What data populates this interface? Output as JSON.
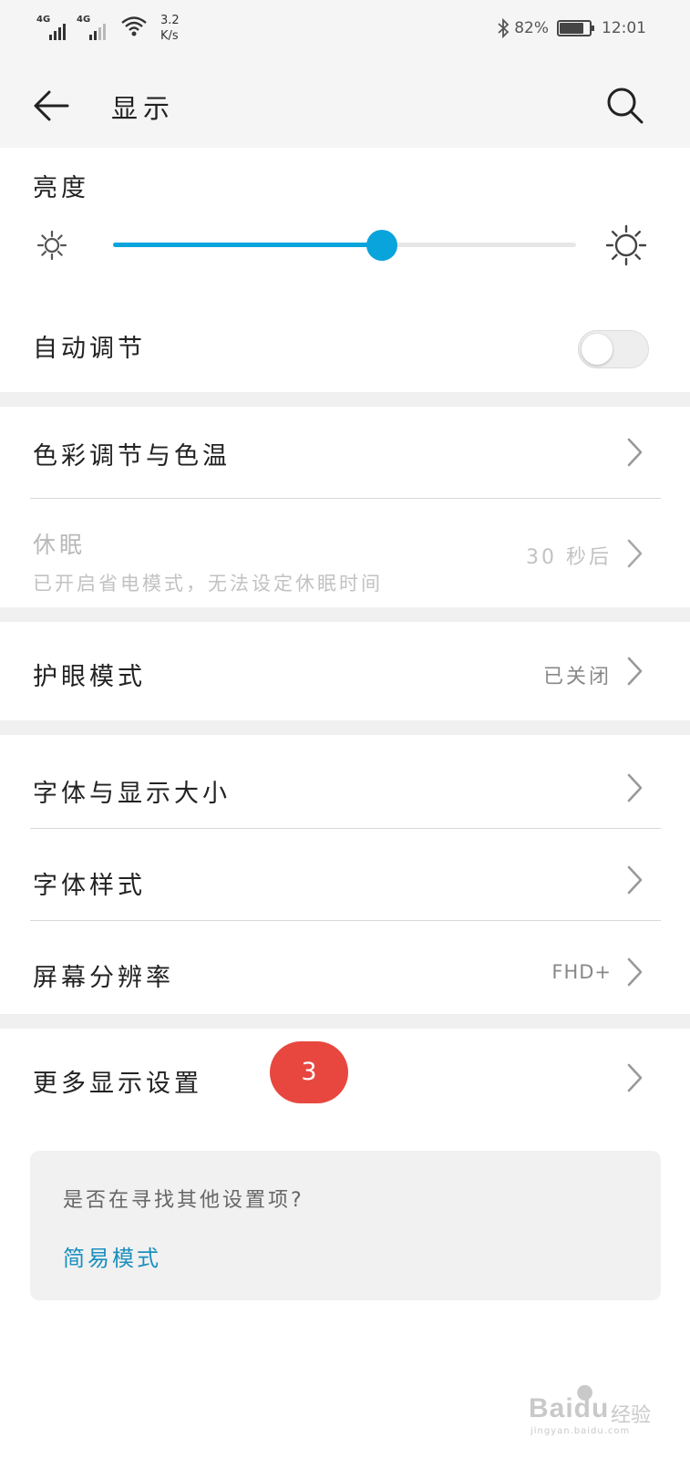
{
  "status_bar": {
    "network_1": "4G",
    "network_2": "4G",
    "speed_value": "3.2",
    "speed_unit": "K/s",
    "battery_percent": "82%",
    "battery_level": 0.82,
    "time": "12:01"
  },
  "header": {
    "title": "显示"
  },
  "brightness": {
    "label": "亮度",
    "level": 0.58
  },
  "auto_adjust": {
    "label": "自动调节",
    "enabled": false
  },
  "items": {
    "color": {
      "label": "色彩调节与色温"
    },
    "sleep": {
      "label": "休眠",
      "subtitle": "已开启省电模式，无法设定休眠时间",
      "value": "30 秒后"
    },
    "eye_comfort": {
      "label": "护眼模式",
      "value": "已关闭"
    },
    "font_size": {
      "label": "字体与显示大小"
    },
    "font_style": {
      "label": "字体样式"
    },
    "resolution": {
      "label": "屏幕分辨率",
      "value": "FHD+"
    },
    "more": {
      "label": "更多显示设置"
    }
  },
  "annotation_badge": "3",
  "suggestion": {
    "question": "是否在寻找其他设置项?",
    "link": "简易模式"
  },
  "watermark": {
    "brand": "Baidu",
    "brand_cn": "经验",
    "url": "jingyan.baidu.com"
  },
  "colors": {
    "accent": "#0aa4dc",
    "badge": "#e8473f",
    "link": "#1b8fbf"
  }
}
